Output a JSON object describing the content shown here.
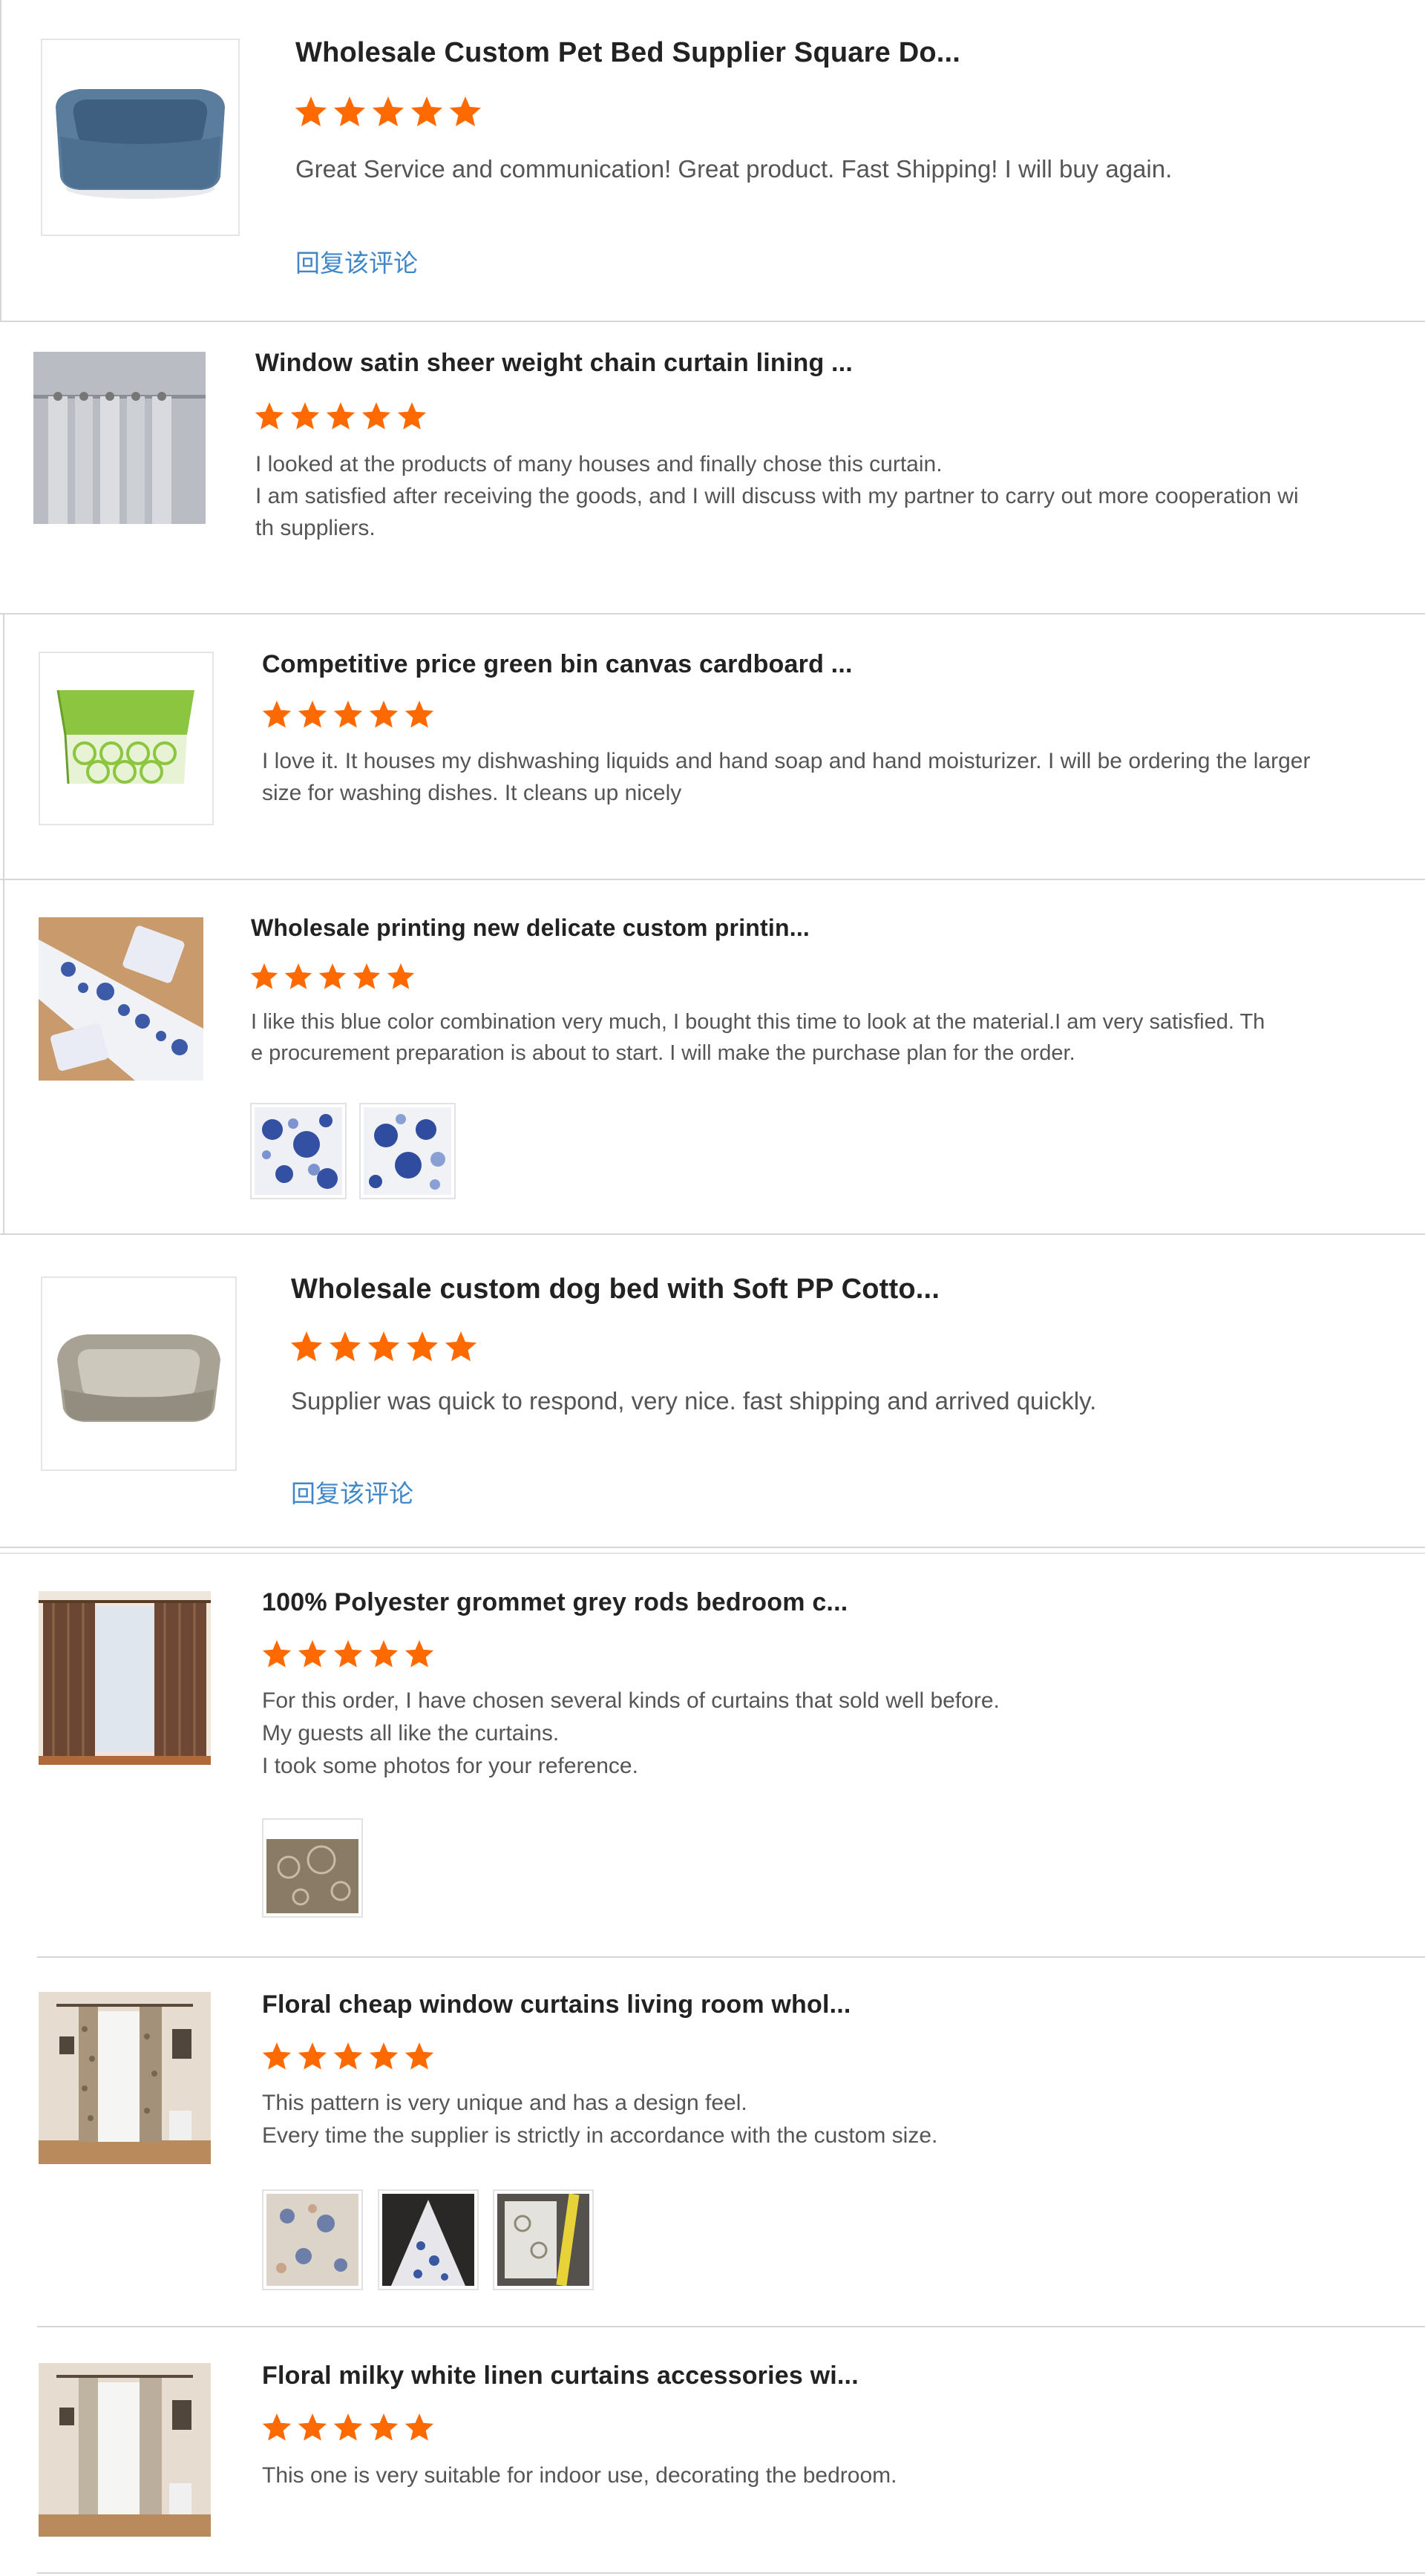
{
  "theme": {
    "star_color": "#ff6a00",
    "link_color": "#3f87c8",
    "border_color": "#d6d6d6"
  },
  "reviews": [
    {
      "title": "Wholesale Custom Pet Bed Supplier Square Do...",
      "rating": 5,
      "lines": [
        "Great Service and communication! Great product. Fast Shipping! I will buy again."
      ],
      "reply_label": "回复该评论",
      "thumb_icon": "blue-square-pet-bed-image"
    },
    {
      "title": "Window satin sheer weight chain curtain lining ...",
      "rating": 5,
      "lines": [
        "I looked at the products of many houses and finally chose this curtain.",
        "I am satisfied after receiving the goods, and I will discuss with my partner to carry out more cooperation wi",
        "th suppliers."
      ],
      "thumb_icon": "grey-curtain-image"
    },
    {
      "title": "Competitive price green bin canvas cardboard ...",
      "rating": 5,
      "lines": [
        "I love it. It houses my dishwashing liquids and hand soap and hand moisturizer. I will be ordering the larger",
        "size for washing dishes. It cleans up nicely"
      ],
      "thumb_icon": "green-storage-bin-image"
    },
    {
      "title": "Wholesale printing new delicate custom printin...",
      "rating": 5,
      "lines": [
        "I like this blue color combination very much, I bought this time to look at the material.I am very satisfied. Th",
        "e procurement preparation is about to start. I will make the purchase plan for the order."
      ],
      "thumb_icon": "blue-floral-table-runner-image",
      "photos": [
        "blue-floral-fabric-photo",
        "blue-floral-fabric-photo"
      ]
    },
    {
      "title": "Wholesale custom dog bed with Soft PP Cotto...",
      "rating": 5,
      "lines": [
        "Supplier was quick to respond, very nice. fast shipping and arrived quickly."
      ],
      "reply_label": "回复该评论",
      "thumb_icon": "beige-dog-bed-image"
    },
    {
      "title": "100% Polyester grommet grey rods bedroom c...",
      "rating": 5,
      "lines": [
        "For this order, I have chosen several kinds of curtains that sold well before.",
        "My guests all like the curtains.",
        "I took some photos for your reference."
      ],
      "thumb_icon": "brown-curtain-image",
      "photos": [
        "circle-pattern-fabric-photo"
      ]
    },
    {
      "title": "Floral cheap window curtains living room whol...",
      "rating": 5,
      "lines": [
        "This pattern is very unique and has a design feel.",
        "Every time the supplier is strictly in accordance with the custom size."
      ],
      "thumb_icon": "floral-curtain-room-image",
      "photos": [
        "floral-fabric-photo",
        "measured-fabric-photo",
        "tape-measure-fabric-photo"
      ]
    },
    {
      "title": "Floral milky white linen curtains accessories wi...",
      "rating": 5,
      "lines": [
        "This one is very suitable for indoor use, decorating the bedroom."
      ],
      "thumb_icon": "linen-curtain-room-image"
    }
  ]
}
